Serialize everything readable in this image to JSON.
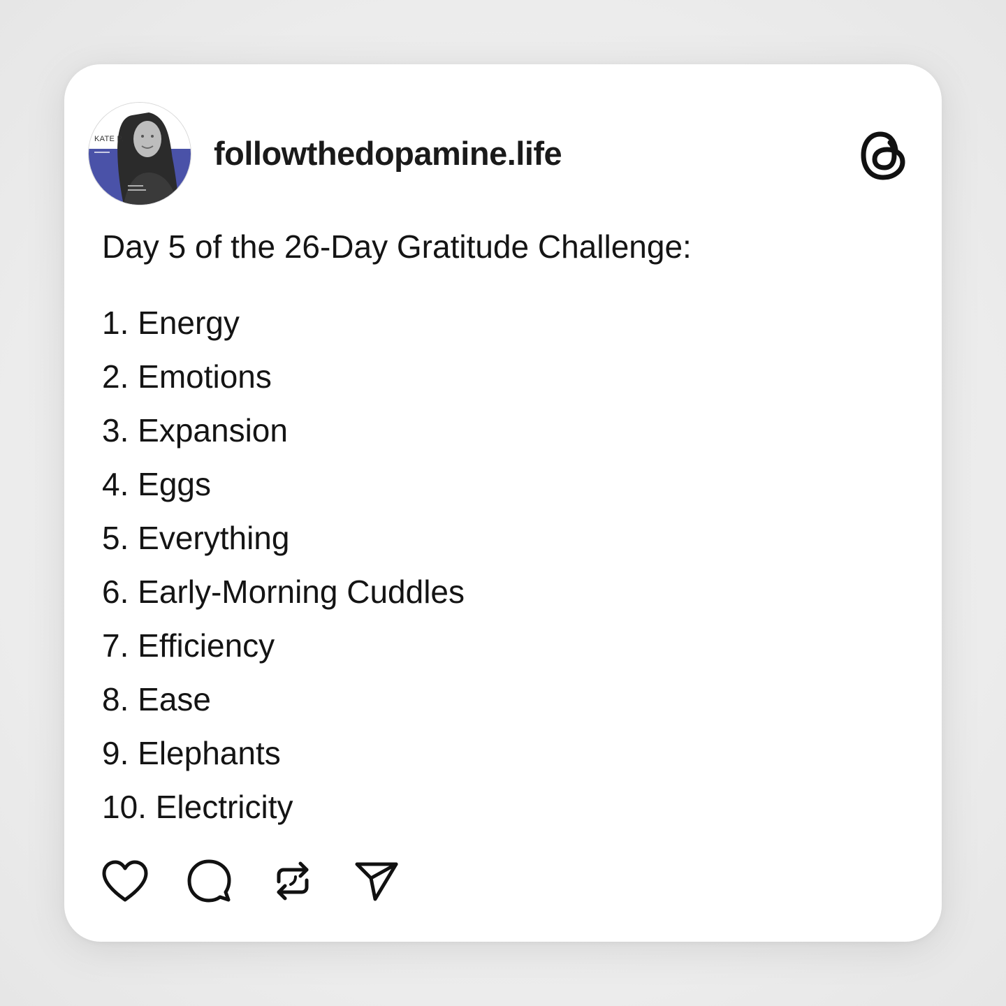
{
  "post": {
    "author": {
      "username": "followthedopamine.life",
      "avatar_caption": "KATE P."
    },
    "brand_icon": "threads-logo-icon",
    "intro": "Day 5 of the 26-Day Gratitude Challenge:",
    "items": [
      "1. Energy",
      "2. Emotions",
      "3. Expansion",
      "4. Eggs",
      "5. Everything",
      "6. Early-Morning Cuddles",
      "7. Efficiency",
      "8. Ease",
      "9. Elephants",
      "10. Electricity"
    ],
    "actions": [
      {
        "icon": "heart-icon"
      },
      {
        "icon": "comment-icon"
      },
      {
        "icon": "repost-icon"
      },
      {
        "icon": "share-icon"
      }
    ]
  },
  "colors": {
    "background": "#ececec",
    "card": "#ffffff",
    "text": "#141414",
    "avatar_accent": "#4a52a8"
  }
}
